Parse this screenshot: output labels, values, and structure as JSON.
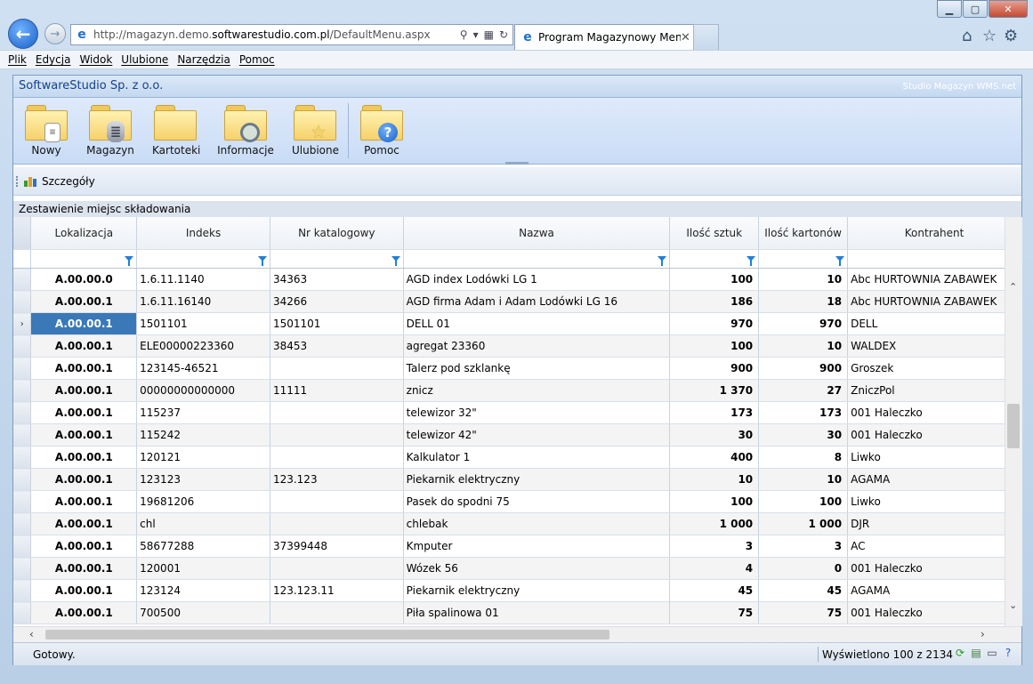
{
  "browser": {
    "url_prefix": "http://magazyn.demo.",
    "url_domain": "softwarestudio.com.pl",
    "url_suffix": "/DefaultMenu.aspx",
    "tab_title": "Program Magazynowy Menu"
  },
  "menu": [
    "Plik",
    "Edycja",
    "Widok",
    "Ulubione",
    "Narzędzia",
    "Pomoc"
  ],
  "app": {
    "company": "SoftwareStudio Sp. z o.o.",
    "brand": "Studio Magazyn WMS.net"
  },
  "ribbon": [
    {
      "label": "Nowy",
      "icon": "document-icon"
    },
    {
      "label": "Magazyn",
      "icon": "database-icon"
    },
    {
      "label": "Kartoteki",
      "icon": "folder-icon"
    },
    {
      "label": "Informacje",
      "icon": "magnifier-icon"
    },
    {
      "label": "Ulubione",
      "icon": "star-icon"
    },
    {
      "label": "Pomoc",
      "icon": "help-icon"
    }
  ],
  "toolbar": {
    "details_label": "Szczegóły"
  },
  "grid": {
    "caption": "Zestawienie miejsc składowania",
    "columns": [
      "Lokalizacja",
      "Indeks",
      "Nr katalogowy",
      "Nazwa",
      "Ilość sztuk",
      "Ilość kartonów",
      "Kontrahent"
    ],
    "rows": [
      [
        "A.00.00.0",
        "1.6.11.1140",
        "34363",
        "AGD index Lodówki LG 1",
        "100",
        "10",
        "Abc HURTOWNIA ZABAWEK"
      ],
      [
        "A.00.00.1",
        "1.6.11.16140",
        "34266",
        "AGD firma Adam i Adam Lodówki LG 16",
        "186",
        "18",
        "Abc HURTOWNIA ZABAWEK"
      ],
      [
        "A.00.00.1",
        "1501101",
        "1501101",
        "DELL 01",
        "970",
        "970",
        "DELL"
      ],
      [
        "A.00.00.1",
        "ELE00000223360",
        "38453",
        "agregat 23360",
        "100",
        "10",
        "WALDEX"
      ],
      [
        "A.00.00.1",
        "123145-46521",
        "",
        "Talerz pod szklankę",
        "900",
        "900",
        "Groszek"
      ],
      [
        "A.00.00.1",
        "00000000000000",
        "11111",
        "znicz",
        "1 370",
        "27",
        "ZniczPol"
      ],
      [
        "A.00.00.1",
        "115237",
        "",
        "telewizor 32\"",
        "173",
        "173",
        "001 Haleczko"
      ],
      [
        "A.00.00.1",
        "115242",
        "",
        "telewizor 42\"",
        "30",
        "30",
        "001 Haleczko"
      ],
      [
        "A.00.00.1",
        "120121",
        "",
        "Kalkulator 1",
        "400",
        "8",
        "Liwko"
      ],
      [
        "A.00.00.1",
        "123123",
        "123.123",
        "Piekarnik elektryczny",
        "10",
        "10",
        "AGAMA"
      ],
      [
        "A.00.00.1",
        "19681206",
        "",
        "Pasek do spodni 75",
        "100",
        "100",
        "Liwko"
      ],
      [
        "A.00.00.1",
        "chl",
        "",
        "chlebak",
        "1 000",
        "1 000",
        "DJR"
      ],
      [
        "A.00.00.1",
        "58677288",
        "37399448",
        "Kmputer",
        "3",
        "3",
        "AC"
      ],
      [
        "A.00.00.1",
        "120001",
        "",
        "Wózek 56",
        "4",
        "0",
        "001 Haleczko"
      ],
      [
        "A.00.00.1",
        "123124",
        "123.123.11",
        "Piekarnik elektryczny",
        "45",
        "45",
        "AGAMA"
      ],
      [
        "A.00.00.1",
        "700500",
        "",
        "Piła spalinowa 01",
        "75",
        "75",
        "001 Haleczko"
      ]
    ],
    "current_row": 2
  },
  "status": {
    "ready": "Gotowy.",
    "count": "Wyświetlono 100 z 2134"
  }
}
